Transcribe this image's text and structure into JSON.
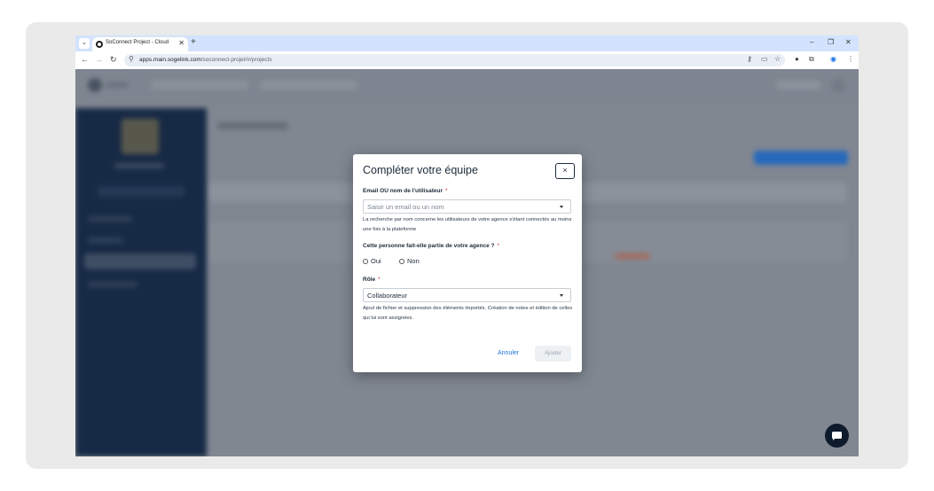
{
  "browser": {
    "tab_title": "SoConnect Project - Cloud",
    "url_host": "apps.main.sogelink.com",
    "url_path": "/soconnect-projet/#/projects",
    "colors": {
      "tabstrip": "#d3e3fd",
      "url_field": "#e9eef6"
    }
  },
  "modal": {
    "title": "Compléter votre équipe",
    "close_label": "×",
    "email_label": "Email OU nom de l'utilisateur",
    "email_required": "*",
    "email_placeholder": "Saisir un email ou un nom",
    "email_help": "La recherche par nom concerne les utilisateurs de votre agence s'étant connectés au moins une fois à la plateforme",
    "agency_label": "Cette personne fait-elle partie de votre agence ?",
    "agency_required": "*",
    "agency_options": [
      "Oui",
      "Non"
    ],
    "role_label": "Rôle",
    "role_required": "*",
    "role_value": "Collaborateur",
    "role_help": "Ajout de fichier et suppression des éléments importés. Création de notes et édition de celles qui lui sont assignées.",
    "cancel_label": "Annuler",
    "submit_label": "Ajouter",
    "colors": {
      "link": "#2474d6",
      "required": "#d62d2d",
      "disabled_bg": "#eef1f4"
    }
  },
  "app": {
    "colors": {
      "sidebar": "#0d2340",
      "accent": "#1f6fd1",
      "chat": "#0e1b2c"
    }
  }
}
